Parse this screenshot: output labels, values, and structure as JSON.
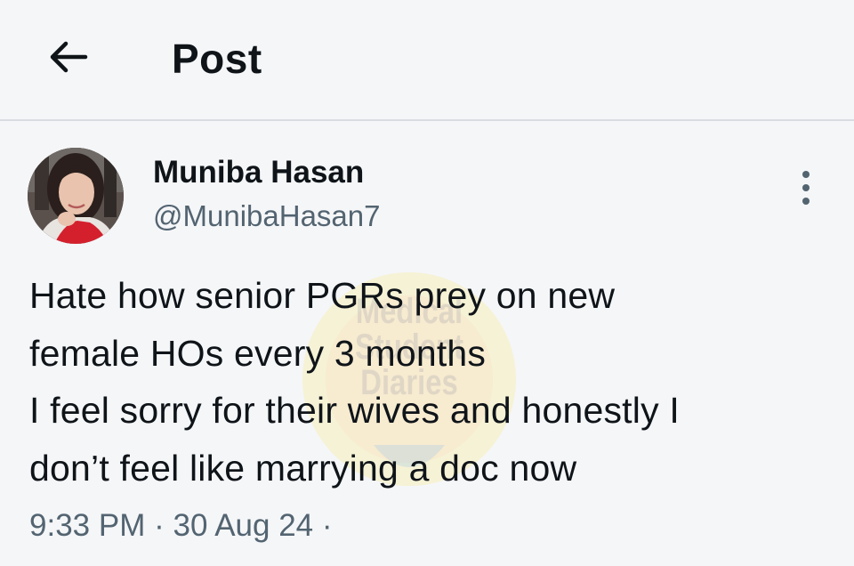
{
  "header": {
    "title": "Post",
    "back_icon": "arrow-left-icon"
  },
  "post": {
    "author": {
      "display_name": "Muniba Hasan",
      "handle": "@MunibaHasan7",
      "avatar_icon": "avatar-photo"
    },
    "text_lines": [
      "Hate how senior PGRs prey on new",
      "female HOs every 3 months",
      "I feel sorry for their wives and honestly I",
      "don’t feel like marrying a doc now"
    ],
    "time": "9:33 PM",
    "separator": "·",
    "date": "30 Aug 24",
    "trailing_separator": "·",
    "more_icon": "more-vertical-icon"
  },
  "watermark": {
    "lines": [
      "Medical",
      "Student",
      "Diaries"
    ]
  },
  "colors": {
    "background": "#f5f6f8",
    "primary_text": "#0f1419",
    "secondary_text": "#536471",
    "divider": "#d9dde2"
  }
}
